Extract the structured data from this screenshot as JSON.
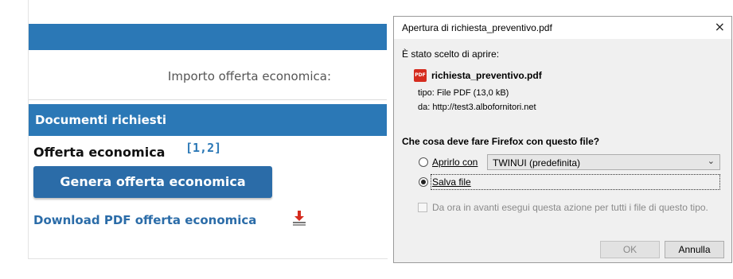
{
  "web": {
    "importo_label": "Importo offerta economica:",
    "section_title": "Documenti richiesti",
    "offer_label": "Offerta economica",
    "offer_refs": "[1,2]",
    "genera_button": "Genera offerta economica",
    "download_link": "Download PDF offerta economica"
  },
  "dialog": {
    "title": "Apertura di richiesta_preventivo.pdf",
    "close_glyph": "×",
    "chosen_text": "È stato scelto di aprire:",
    "file_name": "richiesta_preventivo.pdf",
    "file_type": "tipo:  File PDF (13,0 kB)",
    "file_source": "da:  http://test3.albofornitori.net",
    "question": "Che cosa deve fare Firefox con questo file?",
    "open_with_label": "Aprirlo con",
    "open_with_value": "TWINUI (predefinita)",
    "save_label": "Salva file",
    "remember_label": "Da ora in avanti esegui questa azione per tutti i file di questo tipo.",
    "ok_label": "OK",
    "cancel_label": "Annulla",
    "selected_option": "save"
  },
  "icons": [
    "pdf-icon",
    "download-icon",
    "close-icon",
    "chevron-down-icon"
  ],
  "colors": {
    "accent": "#2b78b6",
    "button": "#2b6ca8",
    "pdf_red": "#d52b1e"
  }
}
